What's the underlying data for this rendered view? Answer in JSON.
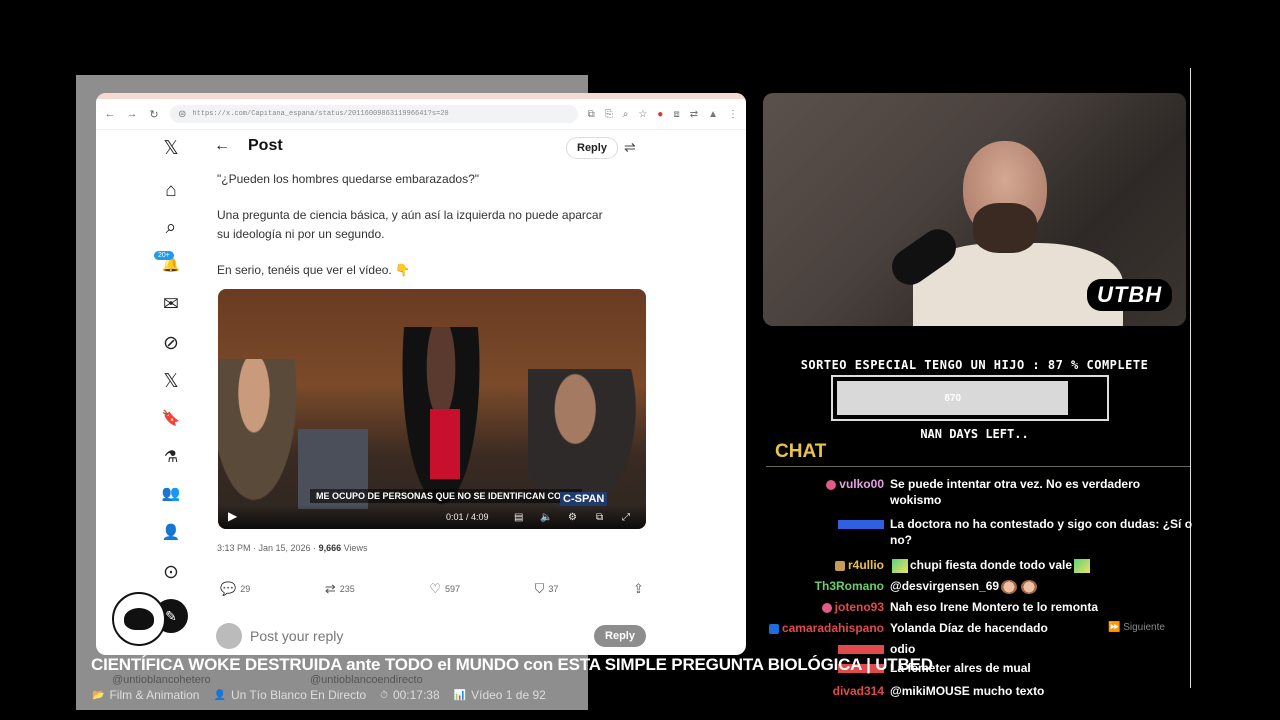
{
  "browser": {
    "url": "https://x.com/Capitana_espana/status/2011600986311996641?s=20",
    "nav": {
      "back": "←",
      "forward": "→",
      "reload": "↻"
    },
    "ext_icons": [
      "⧉",
      "⎘",
      "⌕",
      "☆",
      "●",
      "⧈",
      "⇄",
      "▲",
      "⋮"
    ]
  },
  "sidebar": {
    "icons": [
      {
        "name": "x-logo-icon",
        "glyph": "𝕏"
      },
      {
        "name": "home-icon",
        "glyph": "⌂"
      },
      {
        "name": "search-icon",
        "glyph": "⌕"
      },
      {
        "name": "notifications-icon",
        "glyph": "🔔"
      },
      {
        "name": "messages-icon",
        "glyph": "✉"
      },
      {
        "name": "grok-icon",
        "glyph": "⊘"
      },
      {
        "name": "x-premium-icon",
        "glyph": "𝕏"
      },
      {
        "name": "bookmarks-icon",
        "glyph": "🔖"
      },
      {
        "name": "jobs-icon",
        "glyph": "⚗"
      },
      {
        "name": "communities-icon",
        "glyph": "👥"
      },
      {
        "name": "profile-icon",
        "glyph": "👤"
      },
      {
        "name": "more-icon",
        "glyph": "⊙"
      }
    ],
    "notif_badge": "20+",
    "compose": "✎"
  },
  "post": {
    "back": "←",
    "title": "Post",
    "reply_button": "Reply",
    "quote": "\"¿Pueden los hombres quedarse embarazados?\"",
    "body_line1": "Una pregunta de ciencia básica, y aún así la izquierda no puede aparcar",
    "body_line2": "su ideología ni por un segundo.",
    "body_line3": "En serio, tenéis que ver el vídeo. 👇",
    "video": {
      "caption": "ME OCUPO DE PERSONAS QUE NO SE IDENTIFICAN COMO",
      "logo": "C-SPAN",
      "time": "0:01 / 4:09"
    },
    "meta_time": "3:13 PM · Jan 15, 2026 · ",
    "meta_views_count": "9,666",
    "meta_views_label": " Views",
    "actions": {
      "replies": "29",
      "reposts": "235",
      "likes": "597",
      "bookmarks": "37"
    },
    "reply_placeholder": "Post your reply",
    "reply_submit": "Reply"
  },
  "stream": {
    "brand": "UTBH",
    "progress_label": "SORTEO ESPECIAL TENGO UN HIJO :  87 % COMPLETE",
    "progress_percent": 87,
    "progress_value": "870",
    "days_left": "NAN DAYS LEFT..",
    "chat_title": "CHAT",
    "next_label": "⏩ Siguiente",
    "chat": [
      {
        "name": "vulko00",
        "color": "#e8a0e0",
        "text": "Se puede intentar otra vez. No es verdadero",
        "text2": "wokismo",
        "icon": "pink"
      },
      {
        "name": "",
        "color": "#3060e0",
        "text": "La doctora no ha contestado y sigo con dudas: ¿Sí o",
        "text2": "no?",
        "icon": ""
      },
      {
        "name": "r4ullio",
        "color": "#e8c44a",
        "text": "chupi fiesta donde todo vale",
        "text2": "",
        "icon": "gold"
      },
      {
        "name": "Th3Romano",
        "color": "#6ad06a",
        "text": "@desvirgensen_69",
        "text2": "",
        "icon": ""
      },
      {
        "name": "joteno93",
        "color": "#e04a4a",
        "text": "Nah eso Irene Montero te lo remonta",
        "text2": "",
        "icon": "pink"
      },
      {
        "name": "camaradahispano",
        "color": "#e04a4a",
        "text": "Yolanda Díaz de hacendado",
        "text2": "",
        "icon": "blue"
      },
      {
        "name": "",
        "color": "#e04a4a",
        "text": "odio",
        "text2": "",
        "icon": ""
      },
      {
        "name": "",
        "color": "#e04a4a",
        "text": "La femeter alres de mual",
        "text2": "",
        "icon": ""
      },
      {
        "name": "divad314",
        "color": "#e04a4a",
        "text": "@mikiMOUSE mucho texto",
        "text2": "",
        "icon": ""
      }
    ]
  },
  "video_info": {
    "title": "CIENTÍFICA WOKE DESTRUIDA ante TODO el MUNDO con ESTA SIMPLE PREGUNTA BIOLÓGICA | UTBED",
    "category": "Film & Animation",
    "channel": "Un Tío Blanco En Directo",
    "duration": "00:17:38",
    "position": "Vídeo 1 de 92",
    "ghost_left": "@untioblancohetero",
    "ghost_right": "@untioblancoendirecto"
  }
}
